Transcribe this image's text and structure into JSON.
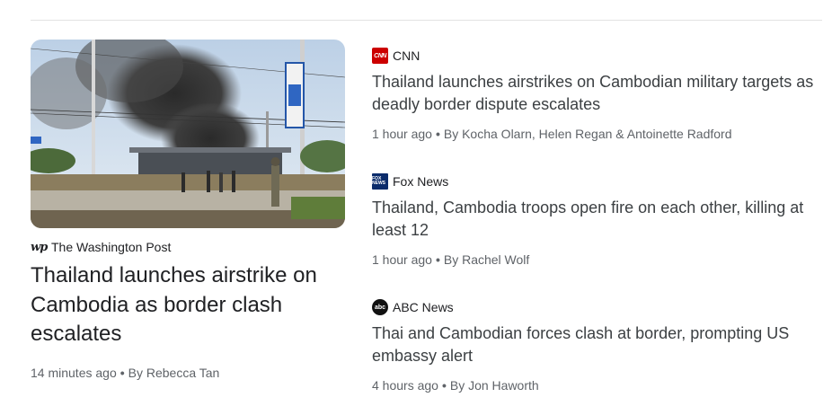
{
  "featured": {
    "source": "The Washington Post",
    "source_logo": "wp",
    "title": "Thailand launches airstrike on Cambodia as border clash escalates",
    "time": "14 minutes ago",
    "byline": "By Rebecca Tan",
    "image_description_icon": "smoke-photo"
  },
  "stories": [
    {
      "source": "CNN",
      "logo_text": "CNN",
      "title": "Thailand launches airstrikes on Cambodian military targets as deadly border dispute escalates",
      "time": "1 hour ago",
      "byline": "By Kocha Olarn, Helen Regan & Antoinette Radford"
    },
    {
      "source": "Fox News",
      "logo_text": "FOX NEWS",
      "title": "Thailand, Cambodia troops open fire on each other, killing at least 12",
      "time": "1 hour ago",
      "byline": "By Rachel Wolf"
    },
    {
      "source": "ABC News",
      "logo_text": "abc",
      "title": "Thai and Cambodian forces clash at border, prompting US embassy alert",
      "time": "4 hours ago",
      "byline": "By Jon Haworth"
    }
  ],
  "separator": "•",
  "colors": {
    "cnn": "#cc0000",
    "fox": "#0b2c6b",
    "abc": "#111111",
    "meta": "#5f6368"
  }
}
